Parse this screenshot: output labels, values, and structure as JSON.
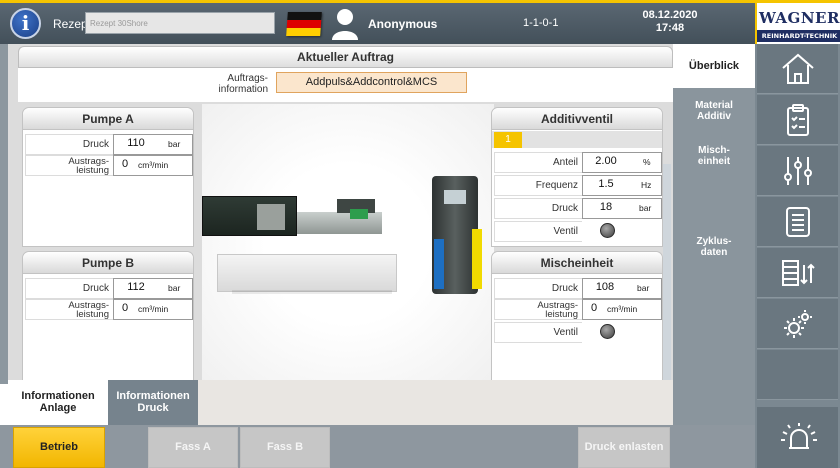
{
  "topbar": {
    "rezept_label": "Rezept",
    "rezept_placeholder": "Rezept 30Shore",
    "user_name": "Anonymous",
    "machine_id": "1-1-0-1",
    "date": "08.12.2020",
    "time": "17:48"
  },
  "logo": {
    "main": "WAGNER",
    "sub": "REINHARDT-TECHNIK"
  },
  "order": {
    "title": "Aktueller Auftrag",
    "label_line1": "Auftrags-",
    "label_line2": "information",
    "value": "Addpuls&Addcontrol&MCS"
  },
  "pumpe_a": {
    "title": "Pumpe A",
    "druck_label": "Druck",
    "druck_value": "110",
    "druck_unit": "bar",
    "austrag_label1": "Austrags-",
    "austrag_label2": "leistung",
    "austrag_value": "0",
    "austrag_unit": "cm³/min"
  },
  "pumpe_b": {
    "title": "Pumpe B",
    "druck_label": "Druck",
    "druck_value": "112",
    "druck_unit": "bar",
    "austrag_label1": "Austrags-",
    "austrag_label2": "leistung",
    "austrag_value": "0",
    "austrag_unit": "cm³/min"
  },
  "additivventil": {
    "title": "Additivventil",
    "tab": "1",
    "anteil_label": "Anteil",
    "anteil_value": "2.00",
    "anteil_unit": "%",
    "frequenz_label": "Frequenz",
    "frequenz_value": "1.5",
    "frequenz_unit": "Hz",
    "druck_label": "Druck",
    "druck_value": "18",
    "druck_unit": "bar",
    "ventil_label": "Ventil"
  },
  "mischeinheit": {
    "title": "Mischeinheit",
    "druck_label": "Druck",
    "druck_value": "108",
    "druck_unit": "bar",
    "austrag_label1": "Austrags-",
    "austrag_label2": "leistung",
    "austrag_value": "0",
    "austrag_unit": "cm³/min",
    "ventil_label": "Ventil"
  },
  "info_tabs": {
    "anlage_line1": "Informationen",
    "anlage_line2": "Anlage",
    "druck_line1": "Informationen",
    "druck_line2": "Druck"
  },
  "buttons": {
    "betrieb": "Betrieb",
    "fass_a": "Fass A",
    "fass_b": "Fass B",
    "druck_enlasten": "Druck enlasten"
  },
  "nav": {
    "ueberblick": "Überblick",
    "material_line1": "Material",
    "material_line2": "Additiv",
    "misch_line1": "Misch-",
    "misch_line2": "einheit",
    "zyklus_line1": "Zyklus-",
    "zyklus_line2": "daten"
  },
  "colors": {
    "accent": "#f5c400",
    "header": "#4b5863",
    "nav": "#8a959d",
    "order_value_bg": "#fbe6cd"
  }
}
